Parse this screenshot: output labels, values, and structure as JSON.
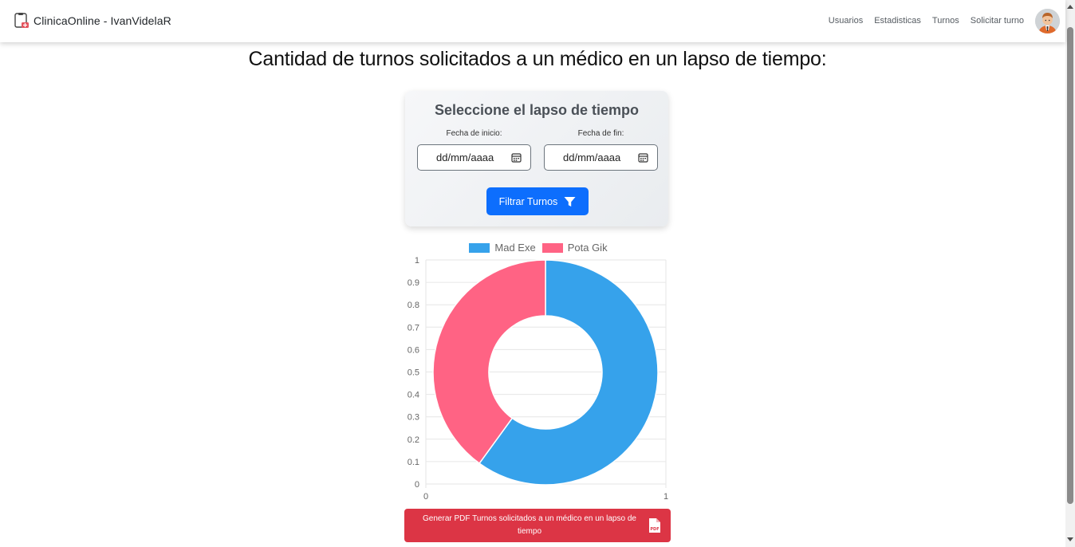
{
  "navbar": {
    "brand": "ClinicaOnline - IvanVidelaR",
    "links": [
      "Usuarios",
      "Estadisticas",
      "Turnos",
      "Solicitar turno"
    ]
  },
  "page": {
    "title": "Cantidad de turnos solicitados a un médico en un lapso de tiempo:"
  },
  "filter": {
    "title": "Seleccione el lapso de tiempo",
    "start_label": "Fecha de inicio:",
    "end_label": "Fecha de fin:",
    "start_value": "dd/mm/aaaa",
    "end_value": "dd/mm/aaaa",
    "button_label": "Filtrar Turnos"
  },
  "chart_data": {
    "type": "pie",
    "labels": [
      "Mad Exe",
      "Pota Gik"
    ],
    "values": [
      60,
      40
    ],
    "colors": [
      "#36a2eb",
      "#ff6384"
    ],
    "legend": "top",
    "grid": true,
    "y_ticks": [
      "1",
      "0.9",
      "0.8",
      "0.7",
      "0.6",
      "0.5",
      "0.4",
      "0.3",
      "0.2",
      "0.1",
      "0"
    ],
    "x_ticks": [
      "0",
      "1"
    ],
    "ylim": [
      0,
      1
    ],
    "xlim": [
      0,
      1
    ]
  },
  "pdf_button": {
    "label": "Generar PDF Turnos solicitados a un médico en un lapso de tiempo"
  }
}
